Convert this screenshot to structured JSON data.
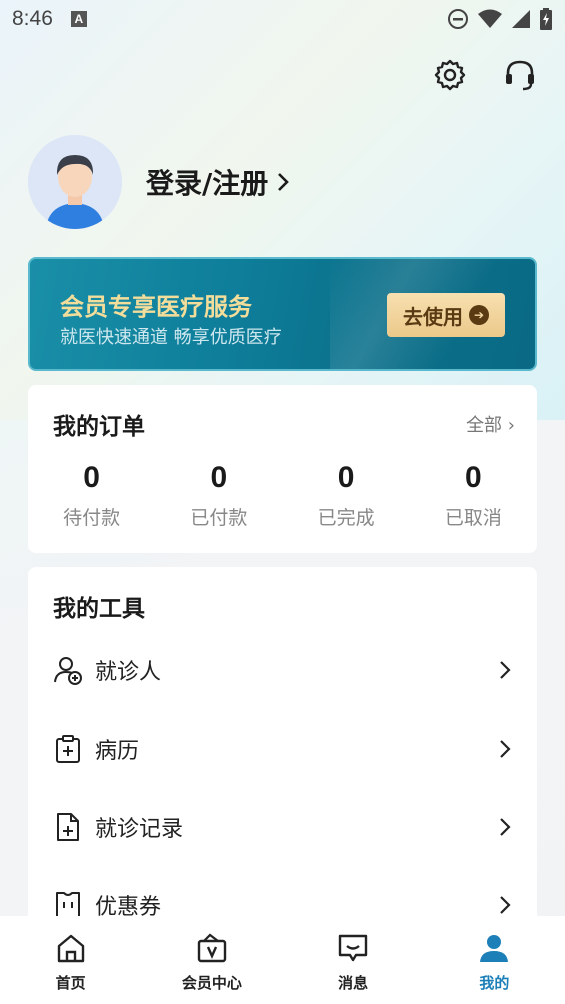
{
  "status_bar": {
    "time": "8:46",
    "badge": "A"
  },
  "header": {
    "settings_icon": "gear-icon",
    "service_icon": "headset-icon"
  },
  "profile": {
    "login_label": "登录/注册"
  },
  "vip_banner": {
    "title": "会员专享医疗服务",
    "subtitle": "就医快速通道 畅享优质医疗",
    "button_label": "去使用"
  },
  "orders": {
    "title": "我的订单",
    "all_label": "全部",
    "stats": [
      {
        "count": "0",
        "label": "待付款"
      },
      {
        "count": "0",
        "label": "已付款"
      },
      {
        "count": "0",
        "label": "已完成"
      },
      {
        "count": "0",
        "label": "已取消"
      }
    ]
  },
  "tools": {
    "title": "我的工具",
    "items": [
      {
        "label": "就诊人",
        "icon": "patient-icon"
      },
      {
        "label": "病历",
        "icon": "medical-record-icon"
      },
      {
        "label": "就诊记录",
        "icon": "visit-record-icon"
      },
      {
        "label": "优惠券",
        "icon": "coupon-icon"
      }
    ]
  },
  "bottom_nav": {
    "items": [
      {
        "label": "首页",
        "icon": "home-icon"
      },
      {
        "label": "会员中心",
        "icon": "vip-icon"
      },
      {
        "label": "消息",
        "icon": "message-icon"
      },
      {
        "label": "我的",
        "icon": "profile-icon"
      }
    ],
    "active_index": 3
  },
  "colors": {
    "accent": "#1c7fb8",
    "banner": "#0e7e9a",
    "gold": "#f3dd9b"
  }
}
